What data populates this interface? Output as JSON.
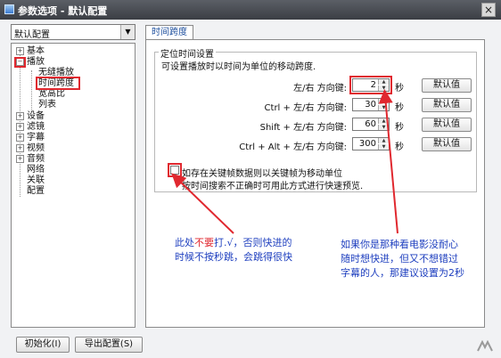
{
  "window": {
    "title": "参数选项 - 默认配置",
    "close_label": "×"
  },
  "profile": {
    "selected": "默认配置",
    "arrow": "▼"
  },
  "tree": {
    "basic": "基本",
    "play": "播放",
    "seamless": "无缝播放",
    "time_span": "时间跨度",
    "aspect": "宽高比",
    "list": "列表",
    "device": "设备",
    "filter": "滤镜",
    "subtitle": "字幕",
    "video": "视频",
    "audio": "音频",
    "network": "网络",
    "assoc": "关联",
    "config": "配置",
    "plus": "+",
    "minus": "−"
  },
  "tab": {
    "label": "时间跨度"
  },
  "group": {
    "title": "定位时间设置",
    "desc": "可设置播放时以时间为单位的移动跨度."
  },
  "rows": [
    {
      "label": "左/右 方向键:",
      "value": "2",
      "unit": "秒",
      "button": "默认值"
    },
    {
      "label": "Ctrl + 左/右 方向键:",
      "value": "30",
      "unit": "秒",
      "button": "默认值"
    },
    {
      "label": "Shift + 左/右 方向键:",
      "value": "60",
      "unit": "秒",
      "button": "默认值"
    },
    {
      "label": "Ctrl + Alt + 左/右 方向键:",
      "value": "300",
      "unit": "秒",
      "button": "默认值"
    }
  ],
  "keyframe": {
    "label": "如存在关键帧数据则以关键帧为移动单位",
    "hint": "按时间搜索不正确时可用此方式进行快速预览."
  },
  "notes": {
    "left_a": "此处",
    "left_b": "不要",
    "left_c": "打.√，否则快进的",
    "left_d": "时候不按秒跳，会跳得很快",
    "right_1": "如果你是那种看电影没耐心",
    "right_2": "随时想快进，但又不想错过",
    "right_3": "字幕的人，那建议设置为2秒"
  },
  "bottom": {
    "init": "初始化(I)",
    "export": "导出配置(S)"
  },
  "spin": {
    "up": "▲",
    "down": "▼"
  },
  "colors": {
    "annotation_red": "#e0282f",
    "annotation_blue": "#1e3fbf"
  }
}
